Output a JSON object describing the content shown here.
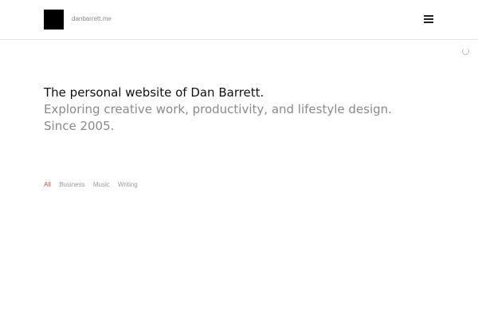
{
  "header": {
    "site_name": "danbarrett.me",
    "logo_icon": "logo-square-icon",
    "menu_icon": "hamburger-menu-icon"
  },
  "intro": {
    "title": "The personal website of Dan Barrett.",
    "subtitle": "Exploring creative work, productivity, and lifestyle design. Since 2005."
  },
  "filters": {
    "active": "All",
    "items": [
      {
        "label": "All"
      },
      {
        "label": "Business"
      },
      {
        "label": "Music"
      },
      {
        "label": "Writing"
      }
    ]
  },
  "colors": {
    "accent": "#e0463a",
    "muted_text": "#8a8a8a",
    "primary_text": "#111111"
  }
}
